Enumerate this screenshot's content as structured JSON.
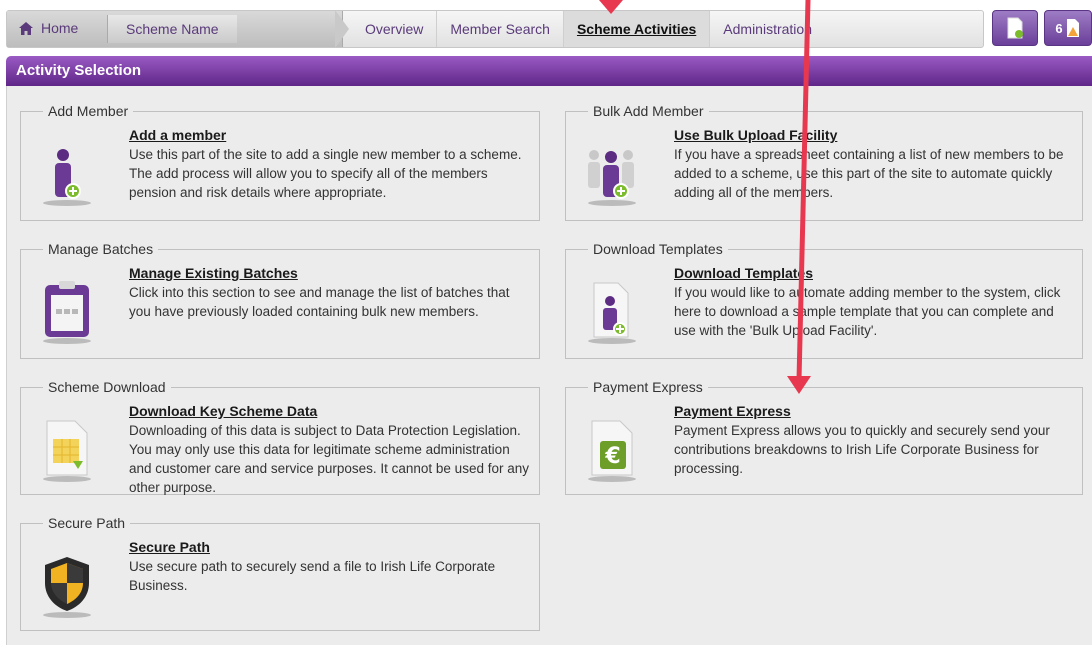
{
  "nav": {
    "home": "Home",
    "scheme": "Scheme Name",
    "tabs": [
      {
        "label": "Overview",
        "active": false
      },
      {
        "label": "Member Search",
        "active": false
      },
      {
        "label": "Scheme Activities",
        "active": true
      },
      {
        "label": "Administration",
        "active": false
      }
    ],
    "badge_count": "6"
  },
  "panel": {
    "title": "Activity Selection"
  },
  "cards": [
    {
      "legend": "Add Member",
      "title": "Add a member",
      "desc": "Use this part of the site to add a single new member to a scheme. The add process will allow you to specify all of the members pension and risk details where appropriate.",
      "icon": "add-member-icon"
    },
    {
      "legend": "Bulk Add Member",
      "title": "Use Bulk Upload Facility",
      "desc": "If you have a spreadsheet containing a list of new members to be added to a scheme, use this part of the site to automate quickly adding all of the members.",
      "icon": "bulk-add-members-icon"
    },
    {
      "legend": "Manage Batches",
      "title": "Manage Existing Batches",
      "desc": "Click into this section to see and manage the list of batches that you have previously loaded containing bulk new members.",
      "icon": "batches-clipboard-icon"
    },
    {
      "legend": "Download Templates",
      "title": "Download Templates",
      "desc": "If you would like to automate adding member to the system, click here to download a sample template that you can complete and use with the 'Bulk Upload Facility'.",
      "icon": "download-template-icon"
    },
    {
      "legend": "Scheme Download",
      "title": "Download Key Scheme Data",
      "desc": "Downloading of this data is subject to Data Protection Legislation. You may only use this data for legitimate scheme administration and customer care and service purposes. It cannot be used for any other purpose.",
      "icon": "spreadsheet-download-icon"
    },
    {
      "legend": "Payment Express",
      "title": "Payment Express",
      "desc": "Payment Express allows you to quickly and securely send your contributions breakdowns to Irish Life Corporate Business for processing.",
      "icon": "euro-document-icon"
    },
    {
      "legend": "Secure Path",
      "title": "Secure Path",
      "desc": "Use secure path to securely send a file to Irish Life Corporate Business.",
      "icon": "security-shield-icon"
    }
  ],
  "colors": {
    "brand_purple": "#6a2e94",
    "arrow_red": "#e8384f"
  }
}
